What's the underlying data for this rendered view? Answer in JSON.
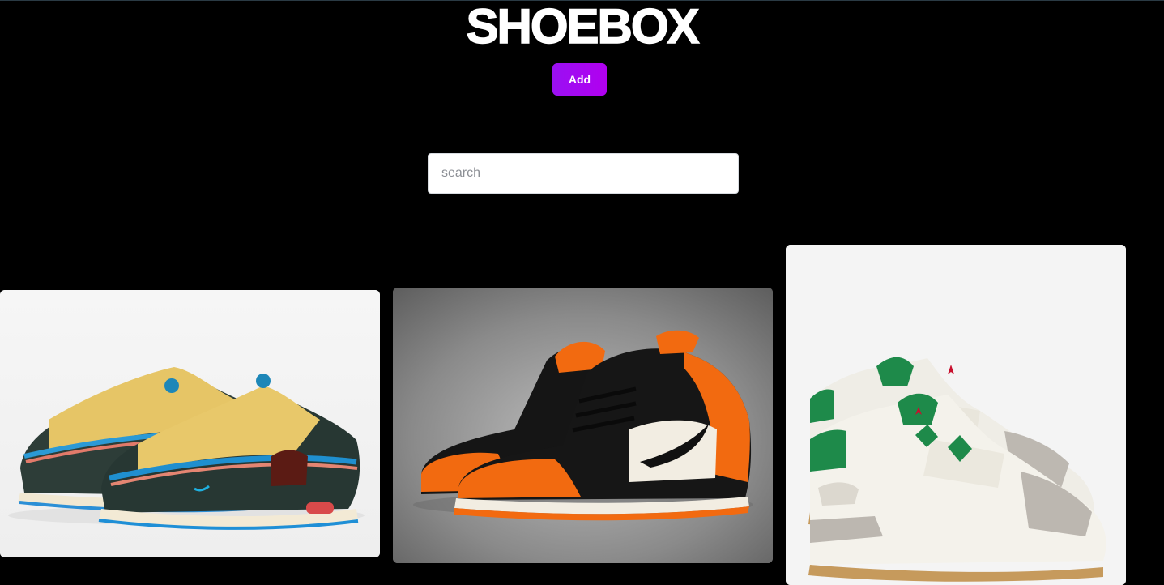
{
  "header": {
    "title": "SHOEBOX",
    "add_label": "Add"
  },
  "search": {
    "placeholder": "search",
    "value": ""
  },
  "products": [
    {
      "image": "sneaker-air-max-1-97-corduroy",
      "colors": [
        "#e8c56a",
        "#2a3a36",
        "#1d8fd0",
        "#f2ead8"
      ]
    },
    {
      "image": "sneaker-air-jordan-1-high-orange-black",
      "colors": [
        "#f26a10",
        "#111111",
        "#f1ece2"
      ]
    },
    {
      "image": "sneaker-air-jordan-4-white-green",
      "colors": [
        "#f1eee6",
        "#1e8a4a",
        "#b9b4ad",
        "#c8102e"
      ]
    }
  ],
  "colors": {
    "background": "#000000",
    "accent": "#a000f0",
    "text": "#ffffff"
  }
}
